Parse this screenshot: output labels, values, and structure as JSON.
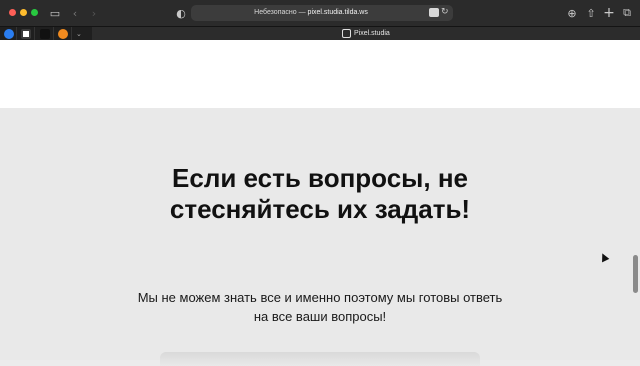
{
  "browser": {
    "address": {
      "prefix": "Небезопасно — ",
      "host": "pixel.studia.tilda.ws"
    },
    "active_tab_title": "Pixel.studia",
    "icons": {
      "sidebar": "sidebar-icon",
      "back": "chevron-left-icon",
      "forward": "chevron-right-icon",
      "shield": "shield-icon",
      "translate": "translate-icon",
      "reload": "reload-icon",
      "download": "download-icon",
      "share": "share-icon",
      "new_tab": "plus-icon",
      "tab_overview": "tabs-icon"
    }
  },
  "content": {
    "headline_line1": "Если есть вопросы, не",
    "headline_line2": "стесняйтесь их задать!",
    "subtext_line1": "Мы не можем знать все и именно поэтому мы готовы ответь",
    "subtext_line2": "на все ваши вопросы!"
  },
  "colors": {
    "page_bg": "#e9e9e9",
    "toolbar_bg": "#2b2b2b",
    "headline": "#111111"
  }
}
